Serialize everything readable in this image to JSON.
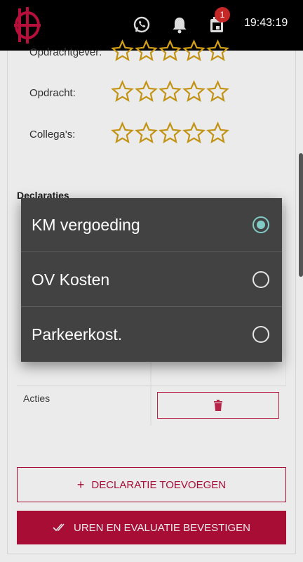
{
  "status_bar": {
    "time": "19:43:19",
    "notification_badge": "1"
  },
  "colors": {
    "brand": "#b70f3b",
    "star": "#d4a017",
    "radio_selected": "#80cbc4"
  },
  "ratings": [
    {
      "label": "Opdrachtgever:",
      "stars": 0,
      "max": 5
    },
    {
      "label": "Opdracht:",
      "stars": 0,
      "max": 5
    },
    {
      "label": "Collega's:",
      "stars": 0,
      "max": 5
    }
  ],
  "declaraties": {
    "title": "Declaraties",
    "acties_label": "Acties"
  },
  "buttons": {
    "add": "DECLARATIE TOEVOEGEN",
    "confirm": "UREN EN EVALUATIE BEVESTIGEN"
  },
  "dialog": {
    "options": [
      {
        "label": "KM vergoeding",
        "selected": true
      },
      {
        "label": "OV Kosten",
        "selected": false
      },
      {
        "label": "Parkeerkost.",
        "selected": false
      }
    ]
  }
}
